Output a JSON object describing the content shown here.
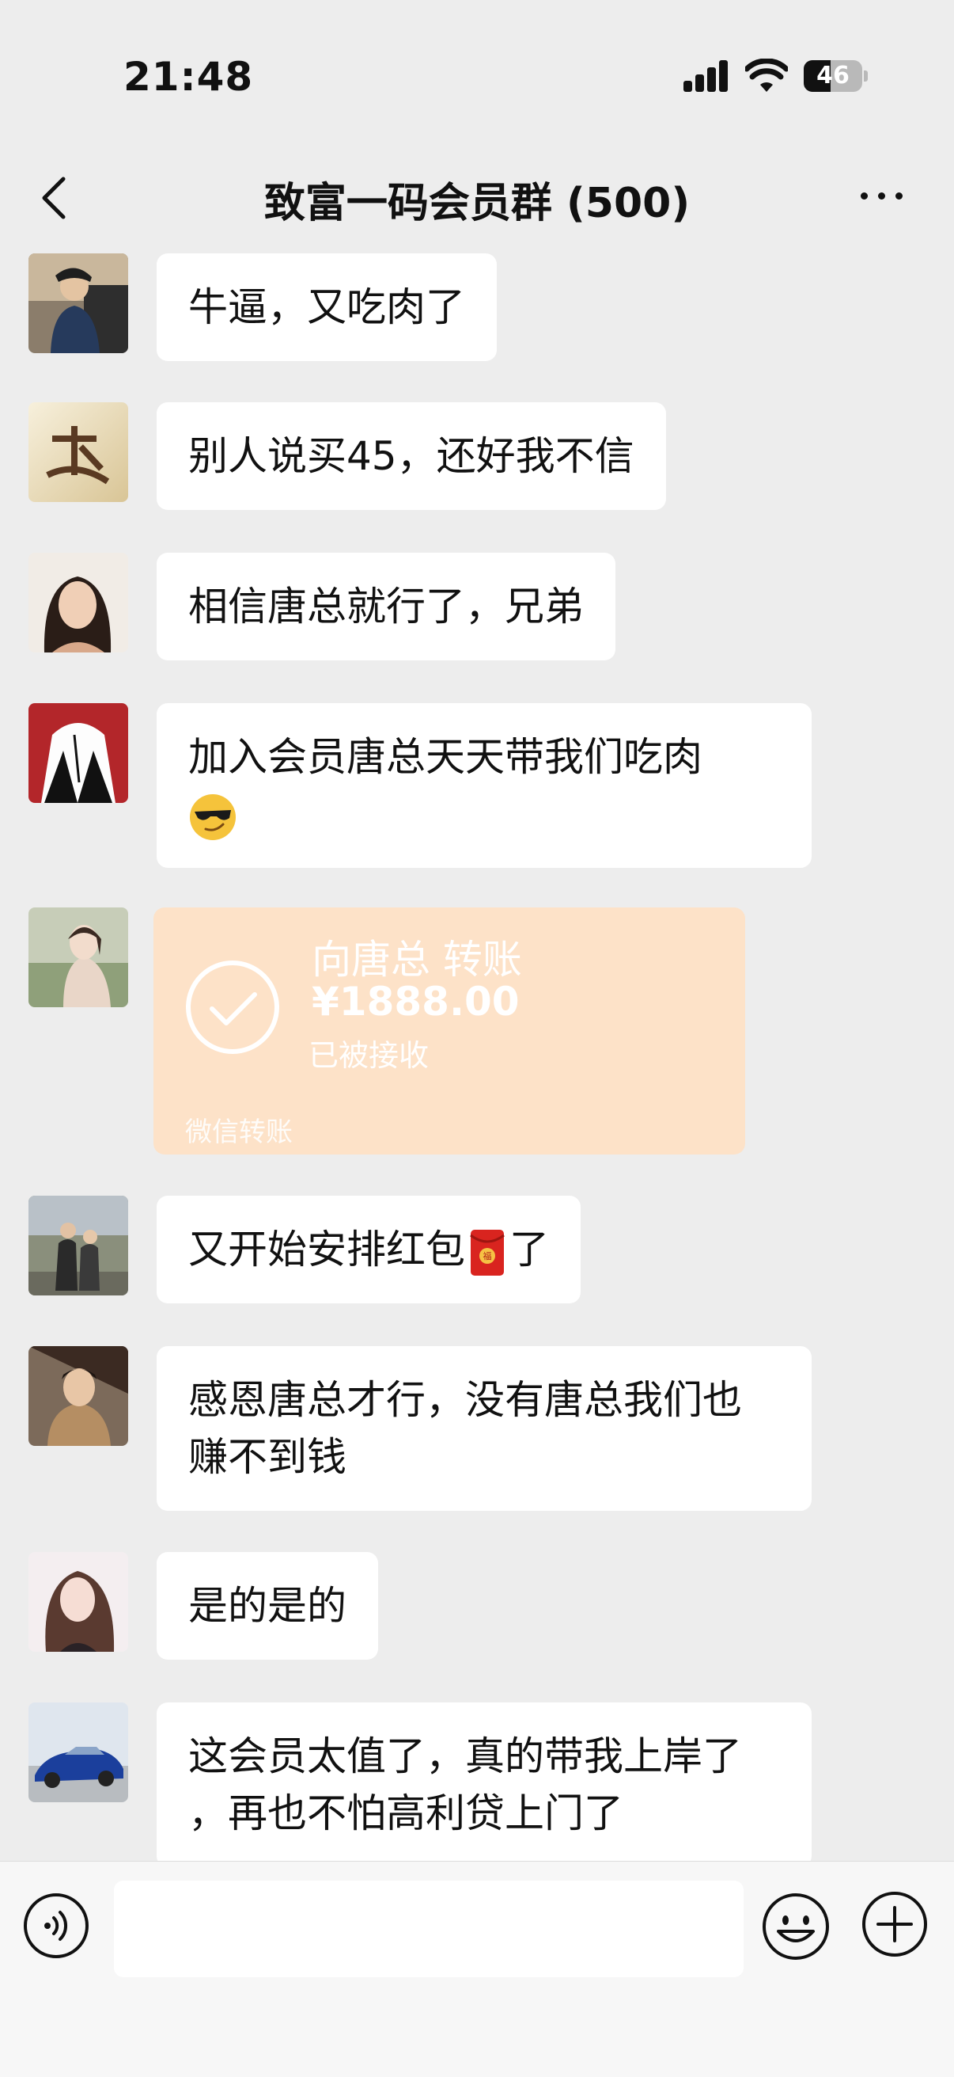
{
  "status_bar": {
    "time": "21:48",
    "battery": "46",
    "battery_level": 0.46
  },
  "nav": {
    "title": "致富一码会员群 (500)"
  },
  "messages": [
    {
      "text": "牛逼，又吃肉了"
    },
    {
      "text": "别人说买45，还好我不信"
    },
    {
      "text": "相信唐总就行了，兄弟"
    },
    {
      "text": "加入会员唐总天天带我们吃肉",
      "emoji": "sunglasses-smirk-emoji"
    },
    {
      "transfer": {
        "title": "向唐总 转账",
        "amount": "¥1888.00",
        "status": "已被接收",
        "footer": "微信转账"
      }
    },
    {
      "text_before": "又开始安排红包",
      "emoji": "red-envelope-emoji",
      "text_after": "了"
    },
    {
      "text_line1": "感恩唐总才行，没有唐总我们也",
      "text_line2": "赚不到钱"
    },
    {
      "text": "是的是的"
    },
    {
      "text_line1": "这会员太值了，真的带我上岸了",
      "text_line2": "，再也不怕高利贷上门了"
    }
  ],
  "input_bar": {
    "placeholder": "",
    "icons": [
      "voice-icon",
      "emoji-icon",
      "plus-icon"
    ]
  },
  "colors": {
    "background": "#ededed",
    "bubble": "#ffffff",
    "transfer": "#fde2c8"
  }
}
